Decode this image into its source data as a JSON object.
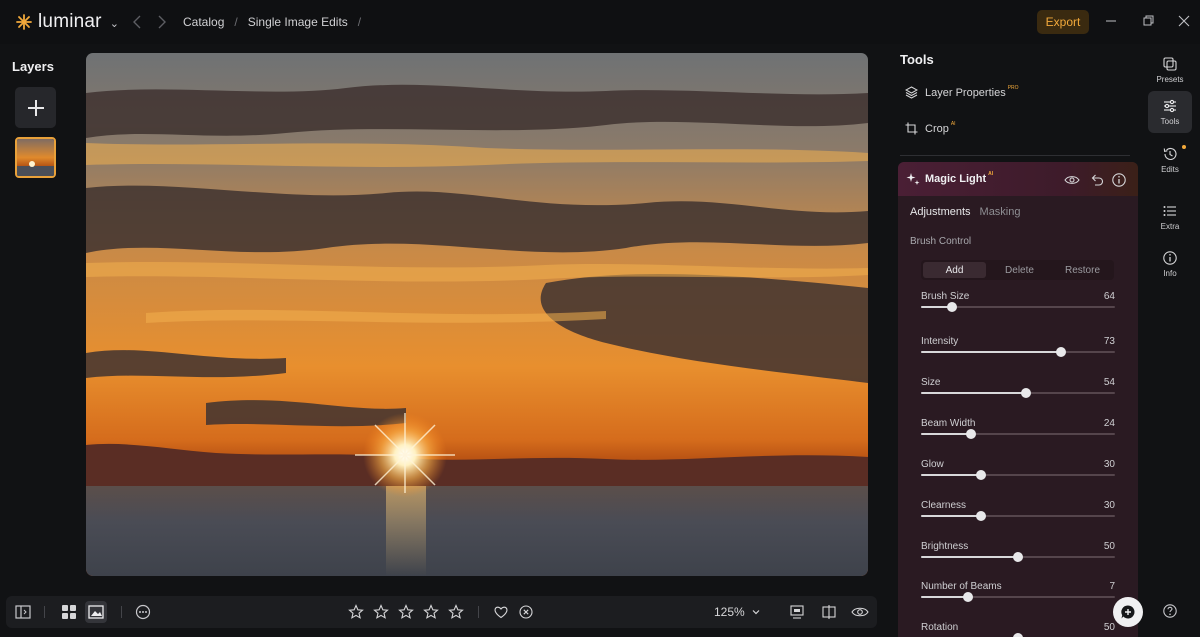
{
  "app": {
    "name": "luminar"
  },
  "nav": {
    "breadcrumbs": [
      "Catalog",
      "Single Image Edits"
    ]
  },
  "header": {
    "export_label": "Export"
  },
  "layers": {
    "title": "Layers"
  },
  "tools": {
    "title": "Tools",
    "layer_properties": {
      "label": "Layer Properties",
      "badge": "PRO"
    },
    "crop": {
      "label": "Crop",
      "badge": "AI"
    }
  },
  "magic_light": {
    "title": "Magic Light",
    "badge": "AI",
    "tabs": [
      "Adjustments",
      "Masking"
    ],
    "brush_control_label": "Brush Control",
    "brush_modes": [
      "Add",
      "Delete",
      "Restore"
    ],
    "active_mode": "Add",
    "sliders": [
      {
        "label": "Brush Size",
        "value": "64",
        "level": 0.16
      },
      {
        "label": "Intensity",
        "value": "73",
        "level": 0.72
      },
      {
        "label": "Size",
        "value": "54",
        "level": 0.54
      },
      {
        "label": "Beam Width",
        "value": "24",
        "level": 0.26
      },
      {
        "label": "Glow",
        "value": "30",
        "level": 0.31
      },
      {
        "label": "Clearness",
        "value": "30",
        "level": 0.31
      },
      {
        "label": "Brightness",
        "value": "50",
        "level": 0.5
      },
      {
        "label": "Number of Beams",
        "value": "7",
        "level": 0.24
      },
      {
        "label": "Rotation",
        "value": "50",
        "level": 0.5
      }
    ]
  },
  "rail": {
    "items": [
      {
        "label": "Presets",
        "icon": "presets-icon"
      },
      {
        "label": "Tools",
        "icon": "tools-icon"
      },
      {
        "label": "Edits",
        "icon": "edits-history-icon"
      },
      {
        "label": "Extra",
        "icon": "extra-list-icon"
      },
      {
        "label": "Info",
        "icon": "info-icon"
      }
    ]
  },
  "bottom": {
    "zoom": "125%",
    "rating_max": 5
  },
  "colors": {
    "accent": "#f2a93b",
    "background": "#111214",
    "magic_panel": "#2a1a22"
  }
}
